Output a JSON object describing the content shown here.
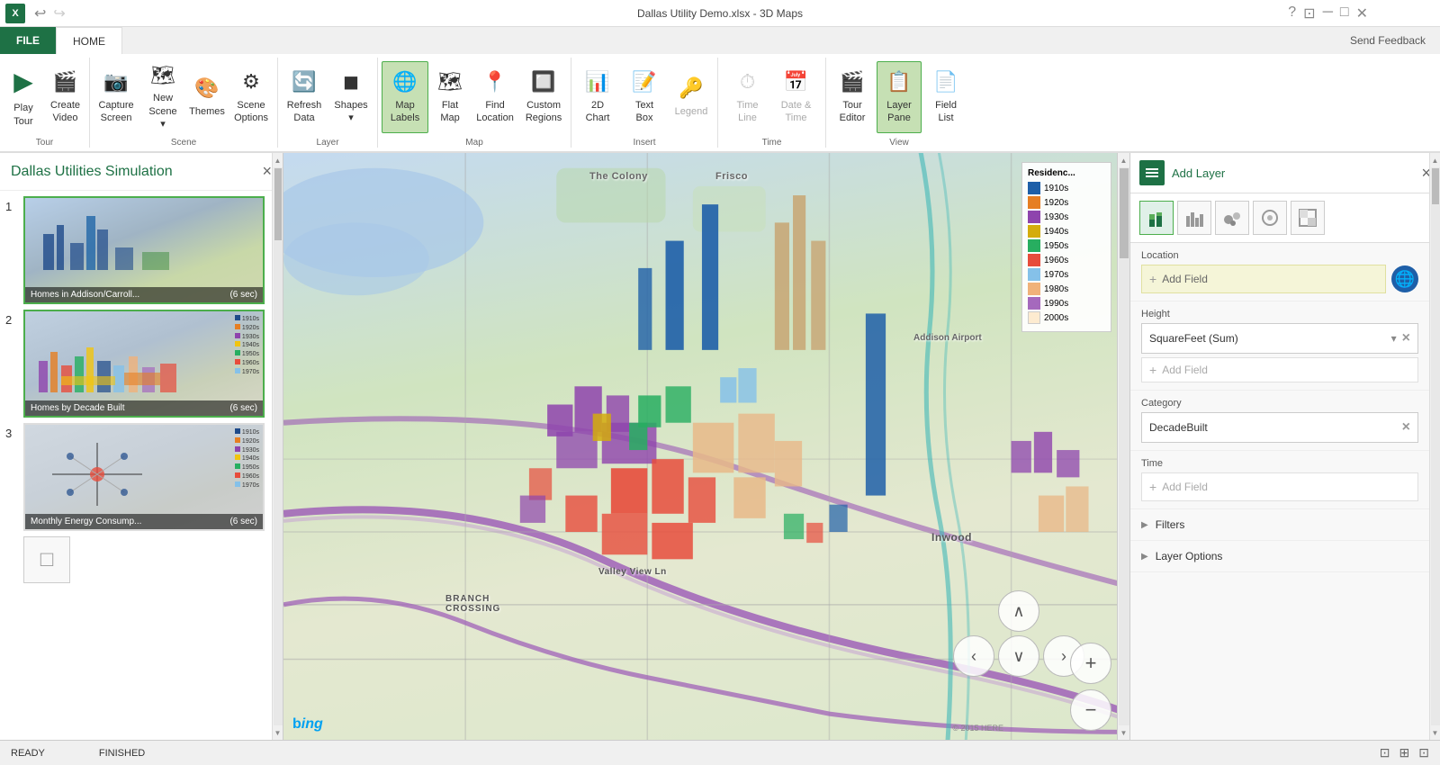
{
  "window": {
    "title": "Dallas Utility Demo.xlsx - 3D Maps",
    "send_feedback": "Send Feedback"
  },
  "tabs": {
    "file_label": "FILE",
    "home_label": "HOME"
  },
  "ribbon": {
    "groups": [
      {
        "name": "Tour",
        "items": [
          {
            "id": "play-tour",
            "label": "Play\nTour",
            "icon": "▶"
          },
          {
            "id": "create-video",
            "label": "Create\nVideo",
            "icon": "🎬"
          }
        ]
      },
      {
        "name": "Scene",
        "items": [
          {
            "id": "capture-screen",
            "label": "Capture\nScreen",
            "icon": "📷"
          },
          {
            "id": "new-scene",
            "label": "New\nScene",
            "icon": "🗺"
          },
          {
            "id": "themes",
            "label": "Themes",
            "icon": "🎨"
          },
          {
            "id": "scene-options",
            "label": "Scene\nOptions",
            "icon": "⚙"
          }
        ]
      },
      {
        "name": "Layer",
        "items": [
          {
            "id": "refresh-data",
            "label": "Refresh\nData",
            "icon": "🔄"
          },
          {
            "id": "shapes",
            "label": "Shapes",
            "icon": "◼"
          }
        ]
      },
      {
        "name": "Map",
        "items": [
          {
            "id": "map-labels",
            "label": "Map\nLabels",
            "icon": "🌐",
            "active": true
          },
          {
            "id": "flat-map",
            "label": "Flat\nMap",
            "icon": "🗺"
          },
          {
            "id": "find-location",
            "label": "Find\nLocation",
            "icon": "📍"
          },
          {
            "id": "custom-regions",
            "label": "Custom\nRegions",
            "icon": "🔲"
          }
        ]
      },
      {
        "name": "Insert",
        "items": [
          {
            "id": "2d-chart",
            "label": "2D\nChart",
            "icon": "📊"
          },
          {
            "id": "text-box",
            "label": "Text\nBox",
            "icon": "📝"
          },
          {
            "id": "legend",
            "label": "Legend",
            "icon": "🔑",
            "disabled": true
          }
        ]
      },
      {
        "name": "Time",
        "items": [
          {
            "id": "time-line",
            "label": "Time\nLine",
            "icon": "⏱",
            "disabled": true
          },
          {
            "id": "date-time",
            "label": "Date &\nTime",
            "icon": "📅",
            "disabled": true
          }
        ]
      },
      {
        "name": "View",
        "items": [
          {
            "id": "tour-editor",
            "label": "Tour\nEditor",
            "icon": "🎬"
          },
          {
            "id": "layer-pane",
            "label": "Layer\nPane",
            "icon": "📋",
            "active": true
          },
          {
            "id": "field-list",
            "label": "Field\nList",
            "icon": "📄"
          }
        ]
      }
    ]
  },
  "scene_panel": {
    "title": "Dallas Utilities Simulation",
    "close_label": "×",
    "scenes": [
      {
        "number": "1",
        "label": "Homes in Addison/Carroll...",
        "duration": "(6 sec)",
        "active": true
      },
      {
        "number": "2",
        "label": "Homes by Decade Built",
        "duration": "(6 sec)",
        "active": false
      },
      {
        "number": "3",
        "label": "Monthly Energy Consump...",
        "duration": "(6 sec)",
        "active": false
      }
    ],
    "add_scene_label": "+"
  },
  "map": {
    "bing_logo": "bing",
    "copyright": "© 2015 HERE",
    "labels": [
      "BRANCH CROSSING",
      "Valley View Ln",
      "Inwood",
      "Frisco",
      "The Colony"
    ],
    "legend_title": "Residences",
    "legend_items": [
      {
        "label": "1910s",
        "color": "#1e5fa8"
      },
      {
        "label": "1920s",
        "color": "#e67e22"
      },
      {
        "label": "1930s",
        "color": "#8e44ad"
      },
      {
        "label": "1940s",
        "color": "#f1c40f"
      },
      {
        "label": "1950s",
        "color": "#27ae60"
      },
      {
        "label": "1960s",
        "color": "#e74c3c"
      },
      {
        "label": "1970s",
        "color": "#85c1e9"
      },
      {
        "label": "1980s",
        "color": "#f0b27a"
      },
      {
        "label": "1990s",
        "color": "#a569bd"
      },
      {
        "label": "2000s",
        "color": "#fdebd0"
      }
    ]
  },
  "right_panel": {
    "add_layer_label": "Add Layer",
    "close_label": "×",
    "layer_types": [
      {
        "id": "stacked-bar",
        "icon": "▦",
        "active": true
      },
      {
        "id": "clustered-bar",
        "icon": "▧",
        "active": false
      },
      {
        "id": "bubble",
        "icon": "⬤",
        "active": false
      },
      {
        "id": "heat",
        "icon": "◉",
        "active": false
      },
      {
        "id": "region",
        "icon": "⬜",
        "active": false
      }
    ],
    "location": {
      "label": "Location",
      "add_field_label": "Add Field",
      "globe_icon": "🌐"
    },
    "height": {
      "label": "Height",
      "value": "SquareFeet (Sum)",
      "add_field_label": "Add Field"
    },
    "category": {
      "label": "Category",
      "value": "DecadeBuilt"
    },
    "time": {
      "label": "Time",
      "add_field_label": "Add Field"
    },
    "filters": {
      "label": "Filters"
    },
    "layer_options": {
      "label": "Layer Options"
    }
  },
  "status_bar": {
    "ready_label": "READY",
    "finished_label": "FINISHED"
  }
}
